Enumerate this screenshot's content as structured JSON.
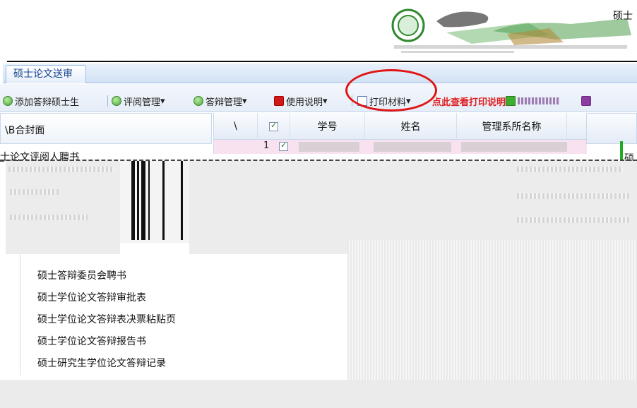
{
  "tabs": [
    {
      "label": "硕士论文送审"
    }
  ],
  "toolbar": {
    "items": [
      {
        "label": "添加答辩硕士生",
        "icon": "add-icon"
      },
      {
        "label": "评阅管理",
        "icon": "add-icon"
      },
      {
        "label": "答辩管理",
        "icon": "add-icon"
      },
      {
        "label": "使用说明",
        "icon": "help-book-icon"
      },
      {
        "label": "打印材料",
        "icon": "document-icon"
      },
      {
        "label": "点此查看打印说明",
        "icon": ""
      }
    ],
    "garbled_labels": [
      "添加答辩硕士生",
      "评阅管理",
      "答辩管理",
      "使用说明",
      "打印材料",
      "点此查看打印说明"
    ],
    "colors": {
      "hint": "#e02020",
      "highlight": "#e01414"
    }
  },
  "tree": {
    "root_label": "\\B合封面",
    "item_label": "士论文评阅人聘书"
  },
  "grid": {
    "columns": [
      "\\",
      "",
      "学号",
      "姓名",
      "管理系所名称"
    ],
    "row_prefix": "1"
  },
  "right_panel": {
    "title": "硕士",
    "row_label": "硕"
  },
  "menu": {
    "items": [
      "硕士答辩委员会聘书",
      "硕士学位论文答辩审批表",
      "硕士学位论文答辩表决票粘贴页",
      "硕士学位论文答辩报告书",
      "硕士研究生学位论文答辩记录"
    ]
  }
}
